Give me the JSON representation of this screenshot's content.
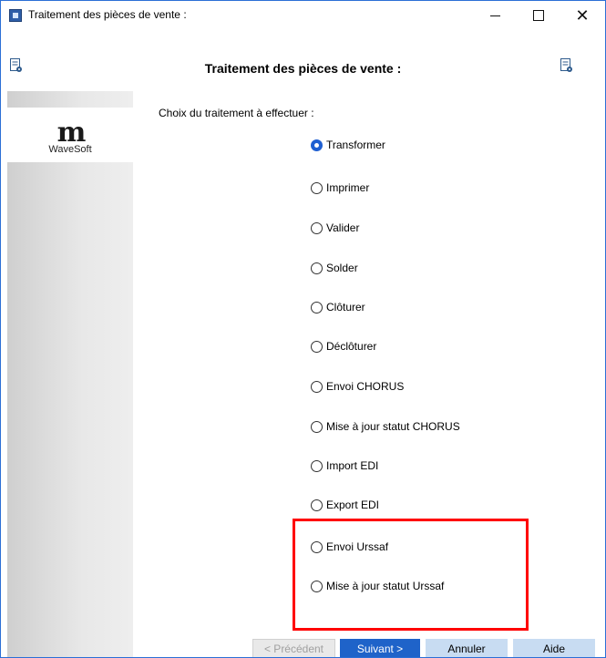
{
  "window": {
    "title": "Traitement des pièces de vente :",
    "minimize_glyph": "—",
    "close_glyph": "✕"
  },
  "header": {
    "title": "Traitement des pièces de vente :"
  },
  "side_panel": {
    "logo_mark": "m",
    "logo_text": "WaveSoft"
  },
  "main": {
    "prompt": "Choix du traitement à effectuer :",
    "options": [
      {
        "label": "Transformer",
        "checked": true
      },
      {
        "label": "Imprimer",
        "checked": false
      },
      {
        "label": "Valider",
        "checked": false
      },
      {
        "label": "Solder",
        "checked": false
      },
      {
        "label": "Clôturer",
        "checked": false
      },
      {
        "label": "Déclôturer",
        "checked": false
      },
      {
        "label": "Envoi CHORUS",
        "checked": false
      },
      {
        "label": "Mise à jour statut CHORUS",
        "checked": false
      },
      {
        "label": "Import EDI",
        "checked": false
      },
      {
        "label": "Export EDI",
        "checked": false
      },
      {
        "label": "Envoi Urssaf",
        "checked": false
      },
      {
        "label": "Mise à jour statut Urssaf",
        "checked": false
      }
    ]
  },
  "buttons": {
    "previous": "< Précédent",
    "next": "Suivant >",
    "cancel": "Annuler",
    "help": "Aide"
  },
  "colors": {
    "accent": "#1f63c9",
    "highlight": "#ff0000",
    "secondary_button": "#c8dcf2"
  }
}
